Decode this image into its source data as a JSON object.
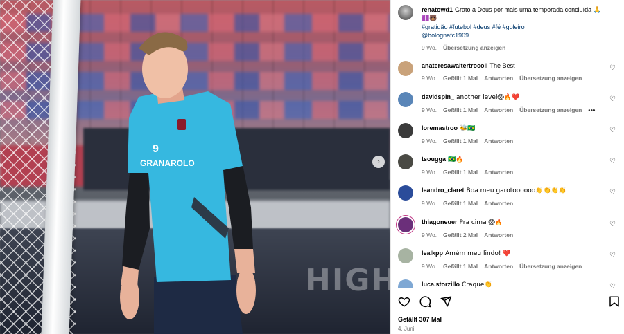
{
  "photo": {
    "board_text": "HIGH",
    "next_button": "›"
  },
  "caption": {
    "username": "renatowd1",
    "text": "Grato a Deus por mais uma temporada concluída",
    "emojis_line1": "🙏",
    "emojis_line2": "✝️🐻",
    "hashtags": "#gratidão #futebol #deus #fé #goleiro",
    "mention": "@bolognafc1909",
    "time": "9 Wo.",
    "translate": "Übersetzung anzeigen"
  },
  "comments": [
    {
      "username": "anateresawaltertrocoli",
      "text": "The Best",
      "time": "9 Wo.",
      "likes": "Gefällt 1 Mal",
      "reply": "Antworten",
      "translate": "Übersetzung anzeigen",
      "avatar_color": "#c9a27a"
    },
    {
      "username": "davidspin_",
      "text": "another level😱🔥❤️",
      "time": "9 Wo.",
      "likes": "Gefällt 1 Mal",
      "reply": "Antworten",
      "translate": "Übersetzung anzeigen",
      "more": "•••",
      "avatar_color": "#5a86b8"
    },
    {
      "username": "loremastroo",
      "text": "🐝🇧🇷",
      "time": "9 Wo.",
      "likes": "Gefällt 1 Mal",
      "reply": "Antworten",
      "translate": "",
      "avatar_color": "#3b3b3b"
    },
    {
      "username": "tsougga",
      "text": "🇧🇷🔥",
      "time": "9 Wo.",
      "likes": "Gefällt 1 Mal",
      "reply": "Antworten",
      "translate": "",
      "avatar_color": "#4a4a44"
    },
    {
      "username": "leandro_claret",
      "text": "Boa meu garotoooooo👏👏👏👏",
      "time": "9 Wo.",
      "likes": "Gefällt 1 Mal",
      "reply": "Antworten",
      "translate": "",
      "avatar_color": "#2b4c9a"
    },
    {
      "username": "thiagoneuer",
      "text": "Pra cima 😱🔥",
      "time": "9 Wo.",
      "likes": "Gefällt 2 Mal",
      "reply": "Antworten",
      "translate": "",
      "avatar_color": "#6b2f7a"
    },
    {
      "username": "lealkpp",
      "text": "Amém meu lindo! ❤️",
      "time": "9 Wo.",
      "likes": "Gefällt 1 Mal",
      "reply": "Antworten",
      "translate": "Übersetzung anzeigen",
      "avatar_color": "#a7b3a2"
    },
    {
      "username": "luca.storzillo",
      "text": "Craque👏",
      "time": "",
      "likes": "",
      "reply": "",
      "translate": "",
      "avatar_color": "#7fa8d4"
    }
  ],
  "footer": {
    "likes": "Gefällt 307 Mal",
    "date": "4. Juni"
  },
  "icons": {
    "like": "heart-icon",
    "comment": "comment-icon",
    "share": "share-icon",
    "save": "bookmark-icon"
  }
}
